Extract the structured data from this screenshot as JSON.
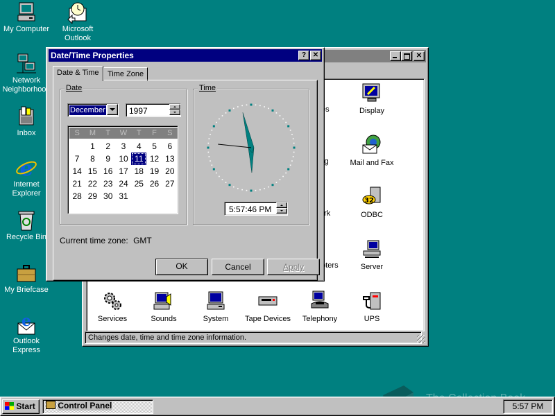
{
  "desktop": {
    "icons": [
      {
        "label": "My Computer"
      },
      {
        "label": "Microsoft Outlook"
      },
      {
        "label": "Network Neighborhood"
      },
      {
        "label": "Inbox"
      },
      {
        "label": "Internet Explorer"
      },
      {
        "label": "Recycle Bin"
      },
      {
        "label": "My Briefcase"
      },
      {
        "label": "Outlook Express"
      }
    ],
    "background_color": "#008080"
  },
  "control_panel": {
    "items_partial": [
      "es",
      "ing",
      "ork",
      "apters"
    ],
    "items": [
      {
        "label": "Display",
        "icon": "display-icon"
      },
      {
        "label": "Mail and Fax",
        "icon": "mail-fax-icon"
      },
      {
        "label": "ODBC",
        "icon": "odbc-icon"
      },
      {
        "label": "Server",
        "icon": "server-icon"
      },
      {
        "label": "Services",
        "icon": "services-icon"
      },
      {
        "label": "Sounds",
        "icon": "sounds-icon"
      },
      {
        "label": "System",
        "icon": "system-icon"
      },
      {
        "label": "Tape Devices",
        "icon": "tape-devices-icon"
      },
      {
        "label": "Telephony",
        "icon": "telephony-icon"
      },
      {
        "label": "UPS",
        "icon": "ups-icon"
      }
    ],
    "status": "Changes date, time and time zone information."
  },
  "dialog": {
    "title": "Date/Time Properties",
    "help_button": "?",
    "close_button": "✕",
    "tabs": [
      {
        "label": "Date & Time"
      },
      {
        "label": "Time Zone"
      }
    ],
    "date_group": "Date",
    "time_group": "Time",
    "month": "December",
    "year": "1997",
    "weekdays": [
      "S",
      "M",
      "T",
      "W",
      "T",
      "F",
      "S"
    ],
    "days": [
      "",
      "1",
      "2",
      "3",
      "4",
      "5",
      "6",
      "7",
      "8",
      "9",
      "10",
      "11",
      "12",
      "13",
      "14",
      "15",
      "16",
      "17",
      "18",
      "19",
      "20",
      "21",
      "22",
      "23",
      "24",
      "25",
      "26",
      "27",
      "28",
      "29",
      "30",
      "31"
    ],
    "selected_day": "11",
    "time_value": "5:57:46 PM",
    "clock": {
      "hours": 5,
      "minutes": 57,
      "seconds": 46
    },
    "timezone_label": "Current time zone:",
    "timezone_value": "GMT",
    "ok": "OK",
    "cancel": "Cancel",
    "apply": "Apply"
  },
  "taskbar": {
    "start": "Start",
    "task": "Control Panel",
    "clock": "5:57 PM"
  },
  "watermark": "The Collection Book"
}
